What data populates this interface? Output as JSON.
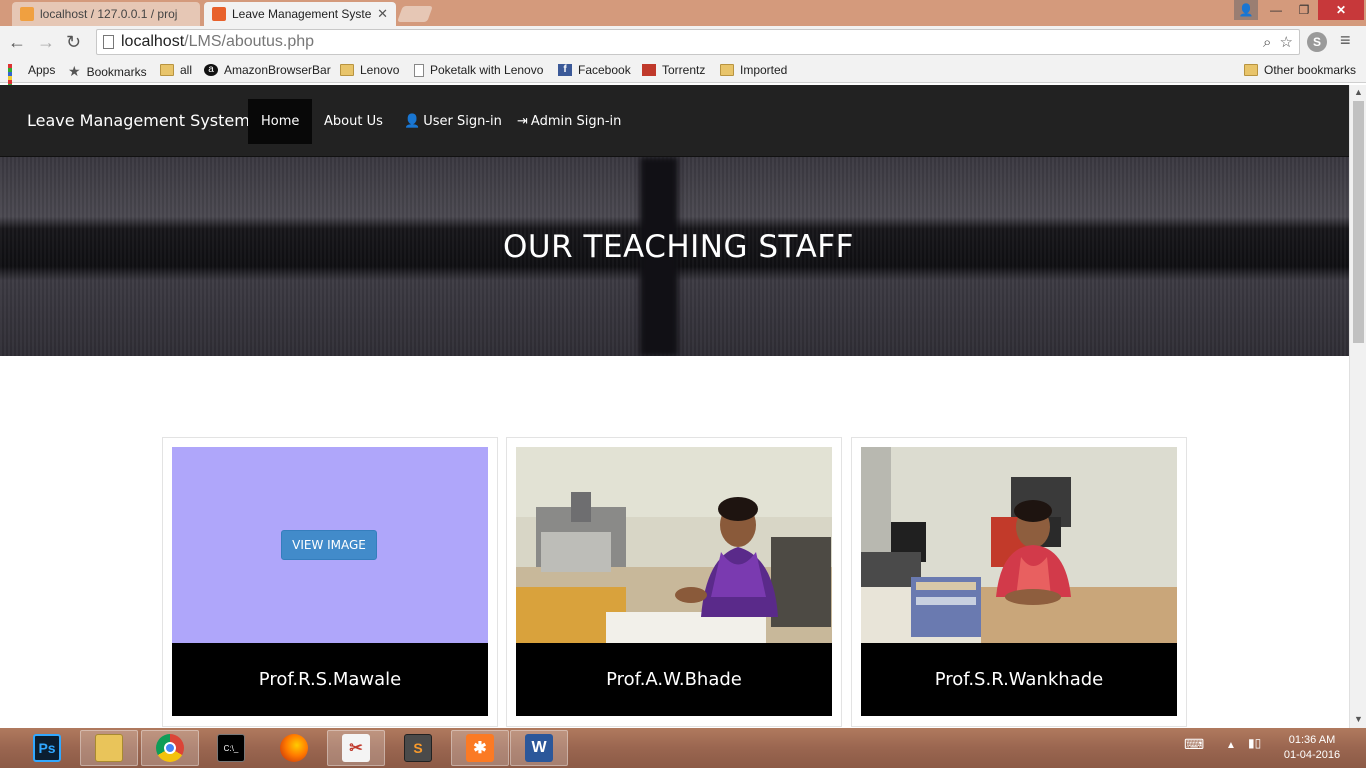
{
  "browser": {
    "tabs": [
      {
        "label": "localhost / 127.0.0.1 / proj",
        "active": false
      },
      {
        "label": "Leave Management Syste",
        "active": true
      }
    ],
    "address": {
      "host": "localhost",
      "path": "/LMS/aboutus.php"
    },
    "bookmarks": [
      {
        "label": "Apps",
        "icon": "apps-grid-icon"
      },
      {
        "label": "Bookmarks",
        "icon": "star-icon"
      },
      {
        "label": "all",
        "icon": "folder-icon"
      },
      {
        "label": "AmazonBrowserBar",
        "icon": "amazon-icon"
      },
      {
        "label": "Lenovo",
        "icon": "folder-icon"
      },
      {
        "label": "Poketalk with Lenovo",
        "icon": "page-icon"
      },
      {
        "label": "Facebook",
        "icon": "facebook-icon"
      },
      {
        "label": "Torrentz",
        "icon": "torrentz-icon"
      },
      {
        "label": "Imported",
        "icon": "folder-icon"
      },
      {
        "label": "Other bookmarks",
        "icon": "folder-icon"
      }
    ]
  },
  "site": {
    "brand": "Leave Management System",
    "nav": [
      {
        "label": "Home",
        "active": true
      },
      {
        "label": "About Us",
        "active": false
      },
      {
        "label": "User Sign-in",
        "active": false,
        "icon": "user-icon"
      },
      {
        "label": "Admin Sign-in",
        "active": false,
        "icon": "login-icon"
      }
    ],
    "hero_title": "OUR TEACHING STAFF",
    "staff": [
      {
        "name": "Prof.R.S.Mawale",
        "button": "VIEW IMAGE",
        "photo": "placeholder"
      },
      {
        "name": "Prof.A.W.Bhade",
        "photo": "teacher-photo"
      },
      {
        "name": "Prof.S.R.Wankhade",
        "photo": "teacher-photo"
      }
    ]
  },
  "taskbar": {
    "apps": [
      "photoshop",
      "file-explorer",
      "chrome",
      "command-prompt",
      "firefox",
      "snipping-tool",
      "sublime-text",
      "xampp",
      "word"
    ],
    "time": "01:36 AM",
    "date": "01-04-2016"
  },
  "colors": {
    "navbar": "#222222",
    "active_nav": "#080808",
    "placeholder": "#afa6fa",
    "button": "#428bca",
    "caption": "#000000"
  }
}
